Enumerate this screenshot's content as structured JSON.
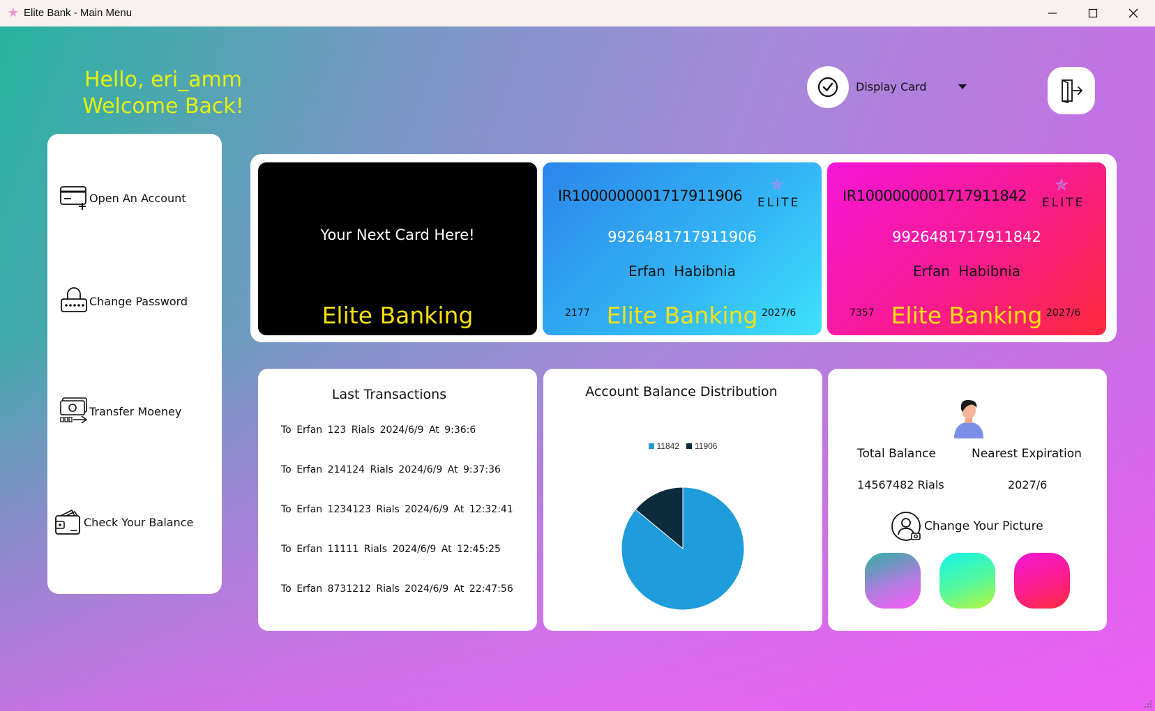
{
  "window": {
    "title": "Elite Bank - Main Menu"
  },
  "greeting": {
    "line1": "Hello, eri_amm",
    "line2": "Welcome Back!"
  },
  "display_card": {
    "label": "Display Card"
  },
  "sidebar": {
    "items": [
      {
        "label": "Open An Account",
        "icon": "card-add-icon"
      },
      {
        "label": "Change Password",
        "icon": "lock-icon"
      },
      {
        "label": "Transfer Moeney",
        "icon": "money-transfer-icon"
      },
      {
        "label": "Check Your Balance",
        "icon": "wallet-icon"
      }
    ]
  },
  "cards": {
    "placeholder": {
      "text": "Your Next Card Here!",
      "brand": "Elite Banking"
    },
    "list": [
      {
        "iban": "IR1000000001717911906",
        "number": "9926481717911906",
        "holder": "Erfan  Habibnia",
        "cvv": "2177",
        "expiry": "2027/6",
        "brand": "Elite Banking",
        "logo": "ELITE"
      },
      {
        "iban": "IR1000000001717911842",
        "number": "9926481717911842",
        "holder": "Erfan  Habibnia",
        "cvv": "7357",
        "expiry": "2027/6",
        "brand": "Elite Banking",
        "logo": "ELITE"
      }
    ]
  },
  "transactions": {
    "title": "Last Transactions",
    "items": [
      "To  Erfan  123 Rials  2024/6/9 At 9:36:6",
      "To  Erfan  214124 Rials  2024/6/9 At 9:37:36",
      "To  Erfan  1234123 Rials  2024/6/9 At 12:32:41",
      "To  Erfan  11111 Rials  2024/6/9 At 12:45:25",
      "To  Erfan  8731212 Rials  2024/6/9 At 22:47:56"
    ]
  },
  "chart_data": {
    "type": "pie",
    "title": "Account Balance Distribution",
    "legend_position": "top",
    "categories": [
      "11842",
      "11906"
    ],
    "values": [
      86,
      14
    ],
    "colors": [
      "#1e9cdc",
      "#0c2b3d"
    ]
  },
  "profile": {
    "total_balance_label": "Total Balance",
    "total_balance_value": "14567482 Rials",
    "nearest_expiration_label": "Nearest Expiration",
    "nearest_expiration_value": "2027/6",
    "change_picture_label": "Change Your Picture",
    "themes": [
      {
        "name": "theme-teal-pink"
      },
      {
        "name": "theme-cyan-green"
      },
      {
        "name": "theme-pink-red"
      }
    ]
  },
  "colors": {
    "greeting": "#e6f00f",
    "brand_text": "#f5e00f",
    "pie_primary": "#1e9cdc",
    "pie_secondary": "#0c2b3d"
  }
}
